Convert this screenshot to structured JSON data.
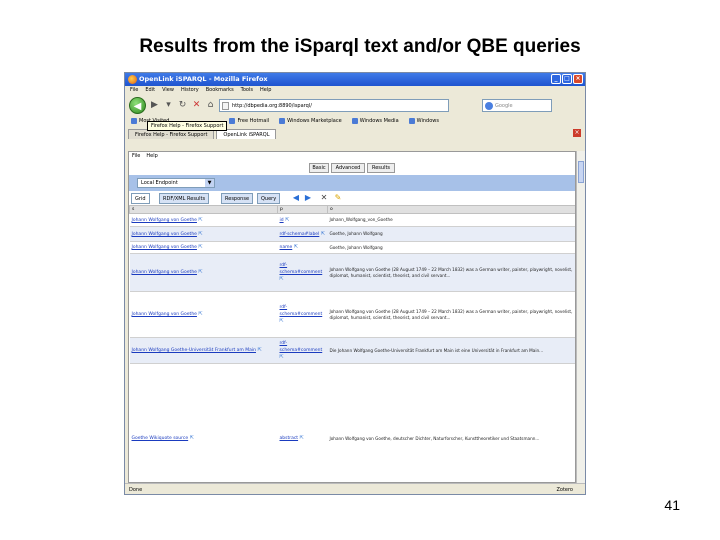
{
  "slide": {
    "title": "Results from the iSparql text and/or QBE queries",
    "page_number": "41"
  },
  "window": {
    "title": "OpenLink iSPARQL - Mozilla Firefox"
  },
  "menubar": [
    "File",
    "Edit",
    "View",
    "History",
    "Bookmarks",
    "Tools",
    "Help"
  ],
  "navbar": {
    "url": "http://dbpedia.org:8890/isparql/",
    "search_placeholder": "Google"
  },
  "bookmarks": {
    "items": [
      "Most Visited",
      "Free Hotmail",
      "Windows Marketplace",
      "Windows Media",
      "Windows"
    ],
    "tooltip": "Firefox Help - Firefox Support"
  },
  "tabs": [
    {
      "label": "Firefox Help - Firefox Support"
    },
    {
      "label": "OpenLink iSPARQL"
    }
  ],
  "app": {
    "menu": [
      "File",
      "Help"
    ],
    "mode_tabs": [
      "Basic",
      "Advanced",
      "Results"
    ],
    "select_value": "Local Endpoint"
  },
  "result_tabs": [
    "Grid",
    "RDF/XML Results",
    "Response",
    "Query"
  ],
  "table": {
    "columns": [
      "s",
      "p",
      "o"
    ],
    "rows": [
      {
        "s": "Johann Wolfgang von Goethe",
        "p": "id",
        "o": "Johann_Wolfgang_von_Goethe",
        "h": 13,
        "s_link": true,
        "p_link": true
      },
      {
        "s": "Johann Wolfgang von Goethe",
        "p": "rdf-schema#label",
        "o": "Goethe, Johann Wolfgang",
        "h": 15,
        "s_link": false,
        "p_link": false
      },
      {
        "s": "Johann Wolfgang von Goethe",
        "p": "name",
        "o": "Goethe, Johann Wolfgang",
        "h": 12,
        "s_link": true,
        "p_link": true
      },
      {
        "s": "Johann Wolfgang von Goethe",
        "p": "rdf-schema#comment",
        "o": "Johann Wolfgang von Goethe (28 August 1749 – 22 March 1832) was a German writer, painter, playwright, novelist, diplomat, humanist, scientist, theorist, and civil servant...",
        "h": 38,
        "s_link": false,
        "p_link": false
      },
      {
        "s": "Johann Wolfgang von Goethe",
        "p": "rdf-schema#comment",
        "o": "Johann Wolfgang von Goethe (28 August 1749 – 22 March 1832) was a German writer, painter, playwright, novelist, diplomat, humanist, scientist, theorist, and civil servant...",
        "h": 46,
        "s_link": true,
        "p_link": false
      },
      {
        "s": "Johann Wolfgang Goethe-Universität Frankfurt am Main",
        "p": "rdf-schema#comment",
        "o": "Die Johann Wolfgang Goethe-Universität Frankfurt am Main ist eine Universität in Frankfurt am Main...",
        "h": 26,
        "s_link": false,
        "p_link": false
      },
      {
        "s": "Goethe Wikiquote source",
        "p": "abstract",
        "o": "Johann Wolfgang von Goethe, deutscher Dichter, Naturforscher, Kunsttheoretiker und Staatsmann...",
        "h": 150,
        "s_link": true,
        "p_link": true
      }
    ]
  },
  "status": {
    "left": "Done",
    "right": "Zotero"
  }
}
